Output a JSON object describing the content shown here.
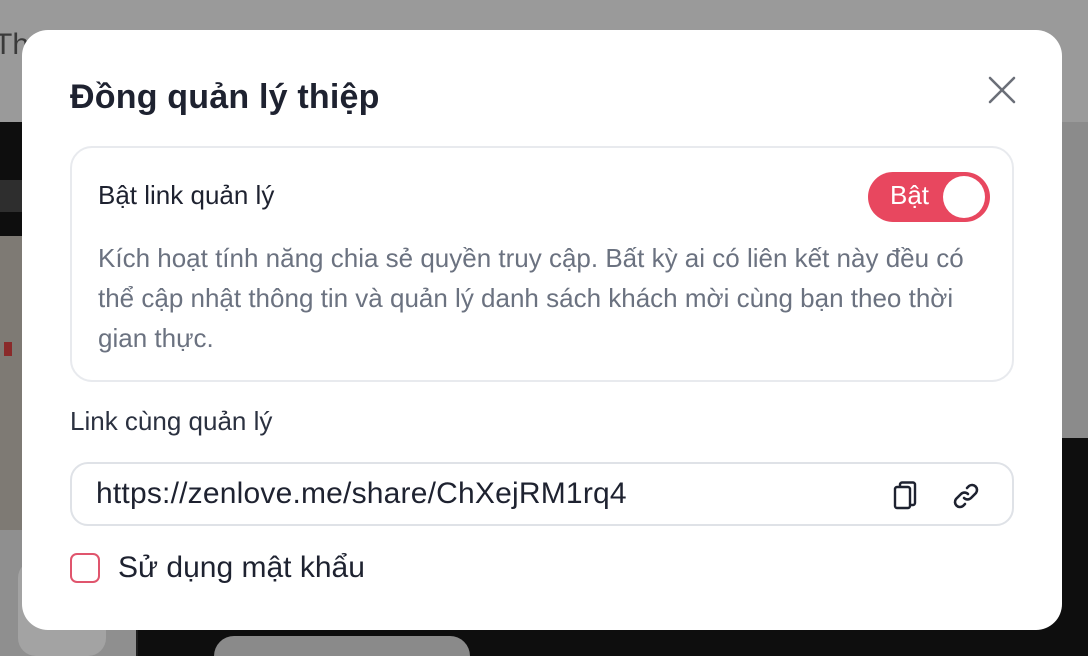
{
  "background": {
    "title_fragment": "Th"
  },
  "modal": {
    "title": "Đồng quản lý thiệp",
    "close_icon": "close-icon",
    "manage_link_card": {
      "title": "Bật link quản lý",
      "toggle_label": "Bật",
      "toggle_on": true,
      "description": "Kích hoạt tính năng chia sẻ quyền truy cập. Bất kỳ ai có liên kết này đều có thể cập nhật thông tin và quản lý danh sách khách mời cùng bạn theo thời gian thực."
    },
    "co_manage_link": {
      "label": "Link cùng quản lý",
      "url": "https://zenlove.me/share/ChXejRM1rq4",
      "copy_icon": "copy-icon",
      "link_icon": "link-icon"
    },
    "password_option": {
      "label": "Sử dụng mật khẩu",
      "checked": false
    }
  },
  "colors": {
    "accent": "#e8475f",
    "title_text": "#1e2230",
    "muted_text": "#6b7280",
    "border": "#e8eaee"
  }
}
